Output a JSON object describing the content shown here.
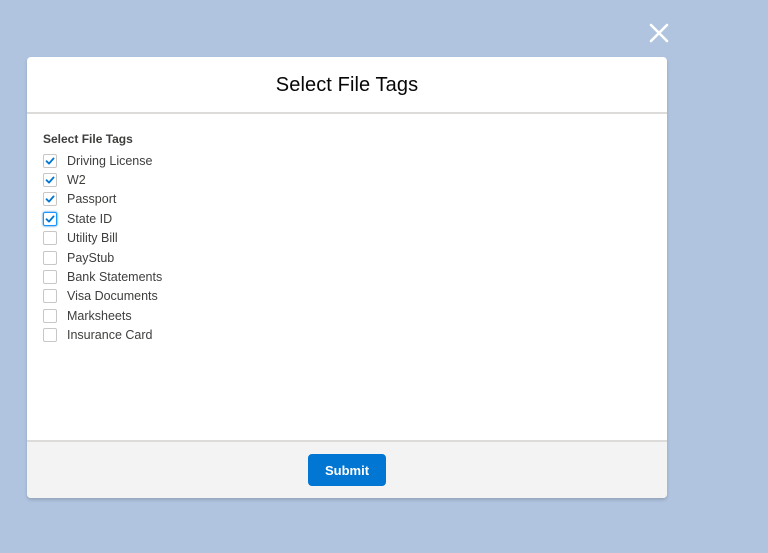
{
  "modal": {
    "title": "Select File Tags",
    "group_label": "Select File Tags",
    "options": [
      {
        "label": "Driving License",
        "checked": true
      },
      {
        "label": "W2",
        "checked": true
      },
      {
        "label": "Passport",
        "checked": true
      },
      {
        "label": "State ID",
        "checked": true,
        "focused": true
      },
      {
        "label": "Utility Bill",
        "checked": false
      },
      {
        "label": "PayStub",
        "checked": false
      },
      {
        "label": "Bank Statements",
        "checked": false
      },
      {
        "label": "Visa Documents",
        "checked": false
      },
      {
        "label": "Marksheets",
        "checked": false
      },
      {
        "label": "Insurance Card",
        "checked": false
      }
    ],
    "submit_label": "Submit"
  },
  "icons": {
    "close": "close-icon",
    "check": "check-icon"
  },
  "colors": {
    "backdrop": "#b0c4df",
    "brand": "#0176d3",
    "footer_bg": "#f3f3f3"
  }
}
